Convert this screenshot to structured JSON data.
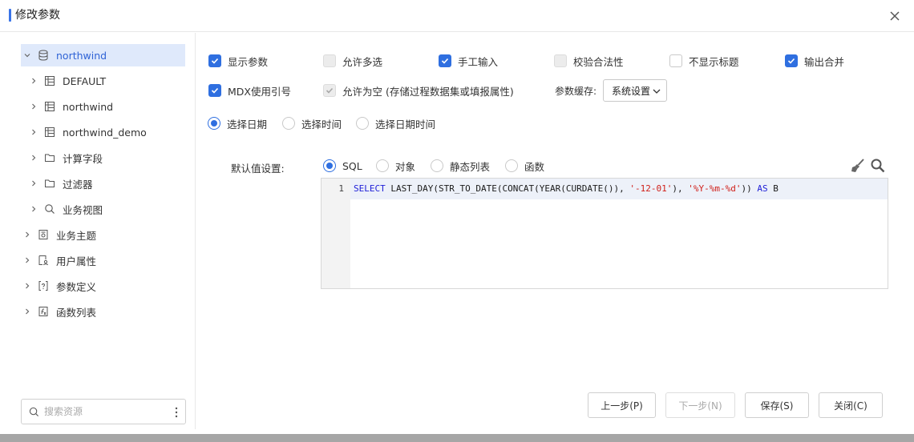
{
  "dialog": {
    "title": "修改参数",
    "close_icon": "close-icon"
  },
  "tree": {
    "root": {
      "label": "northwind",
      "icon": "database-icon",
      "expanded": true,
      "selected": true
    },
    "children": [
      {
        "label": "DEFAULT",
        "icon": "table-icon"
      },
      {
        "label": "northwind",
        "icon": "table-icon"
      },
      {
        "label": "northwind_demo",
        "icon": "table-icon"
      },
      {
        "label": "计算字段",
        "icon": "folder-icon"
      },
      {
        "label": "过滤器",
        "icon": "folder-icon"
      },
      {
        "label": "业务视图",
        "icon": "search-icon"
      }
    ],
    "top_items": [
      {
        "label": "业务主题",
        "icon": "topic-icon"
      },
      {
        "label": "用户属性",
        "icon": "user-attr-icon"
      },
      {
        "label": "参数定义",
        "icon": "param-def-icon"
      },
      {
        "label": "函数列表",
        "icon": "function-list-icon"
      }
    ]
  },
  "search": {
    "placeholder": "搜索资源",
    "value": ""
  },
  "options": {
    "show_param": {
      "label": "显示参数",
      "checked": true
    },
    "allow_multi": {
      "label": "允许多选",
      "checked": false,
      "disabled": true
    },
    "manual_input": {
      "label": "手工输入",
      "checked": true
    },
    "validate": {
      "label": "校验合法性",
      "checked": false,
      "disabled": true
    },
    "hide_title": {
      "label": "不显示标题",
      "checked": false
    },
    "merge_output": {
      "label": "输出合并",
      "checked": true
    },
    "mdx_quote": {
      "label": "MDX使用引号",
      "checked": true
    },
    "allow_empty": {
      "label": "允许为空 (存储过程数据集或填报属性)",
      "checked": true,
      "disabled": true
    }
  },
  "cache": {
    "label": "参数缓存:",
    "value": "系统设置"
  },
  "date_mode": {
    "options": [
      "选择日期",
      "选择时间",
      "选择日期时间"
    ],
    "selected": 0
  },
  "default_value": {
    "label": "默认值设置:",
    "options": [
      "SQL",
      "对象",
      "静态列表",
      "函数"
    ],
    "selected": 0,
    "tools": [
      "brush-icon",
      "search-icon"
    ]
  },
  "editor": {
    "line_number": "1",
    "code": "SELECT LAST_DAY(STR_TO_DATE(CONCAT(YEAR(CURDATE()), '-12-01'), '%Y-%m-%d')) AS B"
  },
  "buttons": {
    "prev": "上一步(P)",
    "next": "下一步(N)",
    "save": "保存(S)",
    "close": "关闭(C)"
  },
  "colors": {
    "accent": "#2f6fe0",
    "selected_bg": "#dfe9fb",
    "keyword": "#2020d8",
    "string": "#d0201a"
  }
}
